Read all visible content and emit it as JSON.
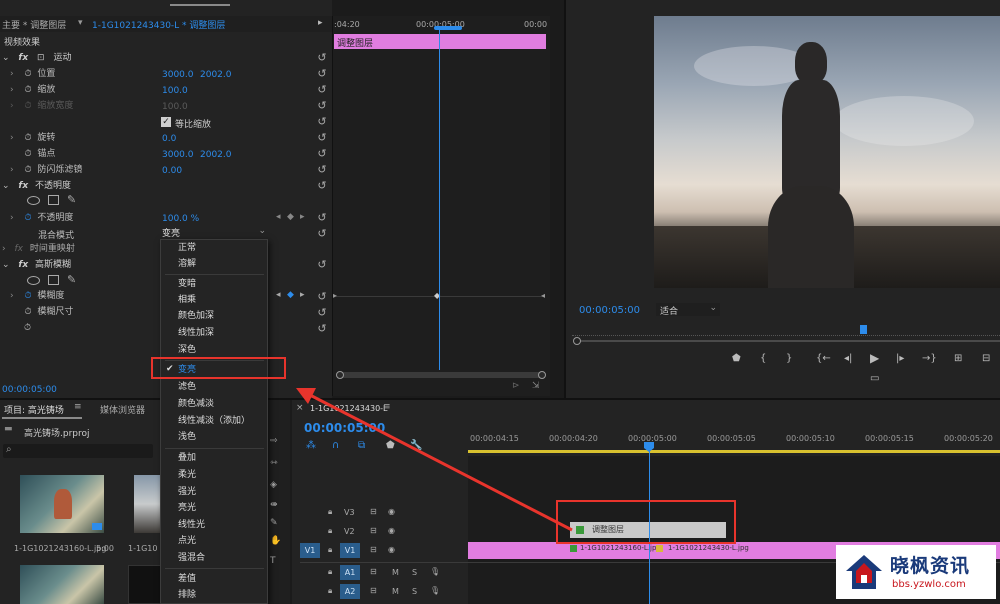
{
  "effect_controls": {
    "header_left": "主要 * 调整图层",
    "header_clip": "1-1G1021243430-L * 调整图层",
    "section": "视频效果",
    "motion": "运动",
    "position_label": "位置",
    "position_x": "3000.0",
    "position_y": "2002.0",
    "scale_label": "缩放",
    "scale_value": "100.0",
    "scale_width_label": "缩放宽度",
    "scale_width_value": "100.0",
    "uniform_scale": "等比缩放",
    "rotation_label": "旋转",
    "rotation_value": "0.0",
    "anchor_label": "锚点",
    "anchor_x": "3000.0",
    "anchor_y": "2002.0",
    "antiflicker_label": "防闪烁滤镜",
    "antiflicker_value": "0.00",
    "opacity_section": "不透明度",
    "opacity_label": "不透明度",
    "opacity_value": "100.0 %",
    "blend_label": "混合模式",
    "blend_value": "变亮",
    "time_remap": "时间重映射",
    "gaussian_blur": "高斯模糊",
    "blurriness_label": "模糊度",
    "blur_dimension_label": "模糊尺寸",
    "current_time": "00:00:05:00"
  },
  "ec_timeline": {
    "t1": ":04:20",
    "t2": "00:00:05:00",
    "t3": "00:00",
    "clip_label": "调整图层"
  },
  "blend_menu": {
    "items": [
      "正常",
      "溶解",
      "变暗",
      "相乘",
      "颜色加深",
      "线性加深",
      "深色",
      "变亮",
      "滤色",
      "颜色减淡",
      "线性减淡（添加）",
      "浅色",
      "叠加",
      "柔光",
      "强光",
      "亮光",
      "线性光",
      "点光",
      "强混合",
      "差值",
      "排除"
    ],
    "selected": "变亮"
  },
  "project": {
    "tab_project": "项目: 高光铸场",
    "tab_media": "媒体浏览器",
    "file": "高光铸场.prproj",
    "thumb1_name": "1-1G1021243160-L.jpg",
    "thumb1_dur": "5:00",
    "thumb2_name": "1-1G10"
  },
  "program": {
    "timecode": "00:00:05:00",
    "fit": "适合"
  },
  "timeline": {
    "tab": "1-1G1021243430-L",
    "timecode": "00:00:05:00",
    "ticks": [
      "00:00:04:15",
      "00:00:04:20",
      "00:00:05:00",
      "00:00:05:05",
      "00:00:05:10",
      "00:00:05:15",
      "00:00:05:20"
    ],
    "tracks": [
      "V3",
      "V2",
      "V1",
      "A1",
      "A2"
    ],
    "v1_src": "V1",
    "adj_clip": "调整图层",
    "clip_a": "1-1G1021243160-L.jpg",
    "clip_b": "1-1G1021243430-L.jpg"
  },
  "watermark": {
    "title": "晓枫资讯",
    "url": "bbs.yzwlo.com"
  },
  "colors": {
    "accent": "#2d8ceb",
    "clip_pink": "#e17de0",
    "annotation": "#e8342c"
  }
}
